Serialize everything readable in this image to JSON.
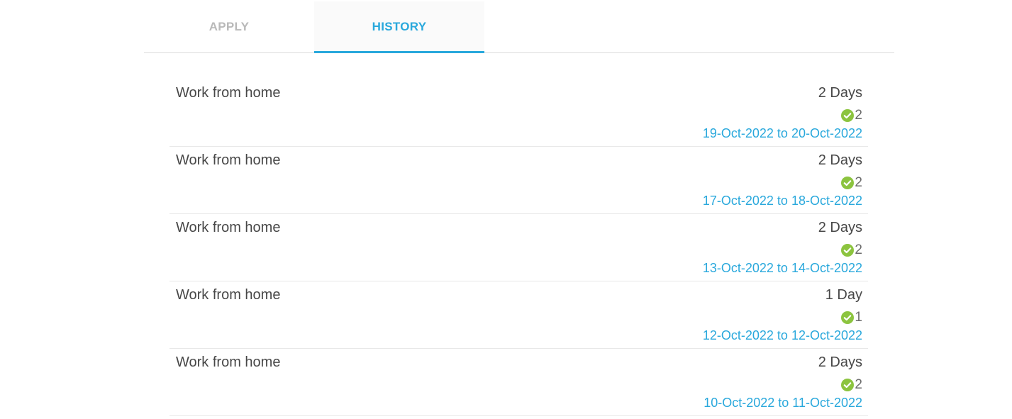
{
  "tabs": [
    {
      "label": "APPLY",
      "active": false
    },
    {
      "label": "HISTORY",
      "active": true
    }
  ],
  "colors": {
    "accent": "#29a8dc",
    "approved": "#8cc43f",
    "text": "#474747",
    "inactive_tab": "#b9b9b9"
  },
  "history": [
    {
      "type": "Work from home",
      "duration": "2 Days",
      "approvals_icon": "check-circle-icon",
      "approvals": "2",
      "range": "19-Oct-2022 to 20-Oct-2022"
    },
    {
      "type": "Work from home",
      "duration": "2 Days",
      "approvals_icon": "check-circle-icon",
      "approvals": "2",
      "range": "17-Oct-2022 to 18-Oct-2022"
    },
    {
      "type": "Work from home",
      "duration": "2 Days",
      "approvals_icon": "check-circle-icon",
      "approvals": "2",
      "range": "13-Oct-2022 to 14-Oct-2022"
    },
    {
      "type": "Work from home",
      "duration": "1 Day",
      "approvals_icon": "check-circle-icon",
      "approvals": "1",
      "range": "12-Oct-2022 to 12-Oct-2022"
    },
    {
      "type": "Work from home",
      "duration": "2 Days",
      "approvals_icon": "check-circle-icon",
      "approvals": "2",
      "range": "10-Oct-2022 to 11-Oct-2022"
    }
  ]
}
